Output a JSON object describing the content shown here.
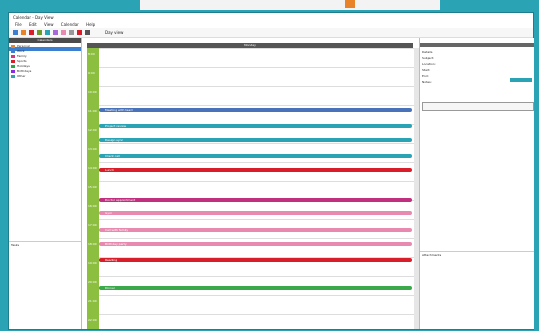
{
  "titlebar": {
    "title": "Calendar - Day View"
  },
  "menubar": {
    "items": [
      "File",
      "Edit",
      "View",
      "Calendar",
      "Help"
    ]
  },
  "toolbar": {
    "hint": "Day view"
  },
  "leftpanel": {
    "header": "Calendars",
    "items": [
      {
        "label": "Personal",
        "color": "#e8832a"
      },
      {
        "label": "Work",
        "color": "#3c7fd1"
      },
      {
        "label": "Family",
        "color": "#d63384"
      },
      {
        "label": "Sports",
        "color": "#d81e2a"
      },
      {
        "label": "Holidays",
        "color": "#28a745"
      },
      {
        "label": "Birthdays",
        "color": "#8a2be2"
      },
      {
        "label": "Other",
        "color": "#2aa3b5"
      }
    ],
    "lower_label": "Tasks"
  },
  "center": {
    "date_header": "Monday"
  },
  "timecol": {
    "hours": [
      "8:00",
      "9:00",
      "10:00",
      "11:00",
      "12:00",
      "13:00",
      "14:00",
      "15:00",
      "16:00",
      "17:00",
      "18:00",
      "19:00",
      "20:00",
      "21:00",
      "22:00"
    ]
  },
  "events": [
    {
      "label": "Meeting with team",
      "color": "#4a72b8"
    },
    {
      "label": "Project review",
      "color": "#2aa3b5"
    },
    {
      "label": "Design sync",
      "color": "#2aa3b5"
    },
    {
      "label": "Client call",
      "color": "#2aa3b5"
    },
    {
      "label": "Lunch",
      "color": "#d81e2a"
    },
    {
      "label": "Doctor appointment",
      "color": "#c0307f"
    },
    {
      "label": "Gym",
      "color": "#e88ab0"
    },
    {
      "label": "Call with family",
      "color": "#e88ab0"
    },
    {
      "label": "Birthday party",
      "color": "#e88ab0"
    },
    {
      "label": "Reading",
      "color": "#d81e2a"
    },
    {
      "label": "Dinner",
      "color": "#3ba84a"
    }
  ],
  "rightpanel": {
    "lines": [
      "Details",
      "Subject:",
      "Location:",
      "Start:",
      "End:",
      "Notes:"
    ],
    "section": "Attachments"
  }
}
